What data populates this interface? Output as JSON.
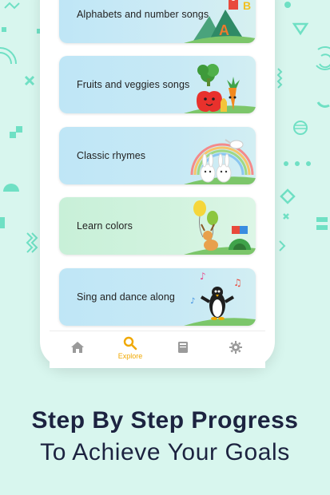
{
  "songs": [
    {
      "label": "Alphabets and number songs",
      "color": "#bfe6f6"
    },
    {
      "label": "Fruits and veggies songs",
      "color": "#bfe6f6"
    },
    {
      "label": "Classic rhymes",
      "color": "#bfe6f6"
    },
    {
      "label": "Learn colors",
      "color": "#c8f0d8"
    },
    {
      "label": "Sing and dance along",
      "color": "#bfe6f6"
    }
  ],
  "tabs": [
    {
      "name": "home",
      "label": "",
      "icon": "home-icon"
    },
    {
      "name": "explore",
      "label": "Explore",
      "icon": "search-icon",
      "active": true
    },
    {
      "name": "library",
      "label": "",
      "icon": "book-icon"
    },
    {
      "name": "settings",
      "label": "",
      "icon": "gear-icon"
    }
  ],
  "headline": {
    "line1": "Step By Step Progress",
    "line2": "To Achieve Your Goals"
  },
  "colors": {
    "background": "#d8f6ee",
    "accent": "#f0a800",
    "text_dark": "#1c2340",
    "deco": "#6fe0c4"
  }
}
